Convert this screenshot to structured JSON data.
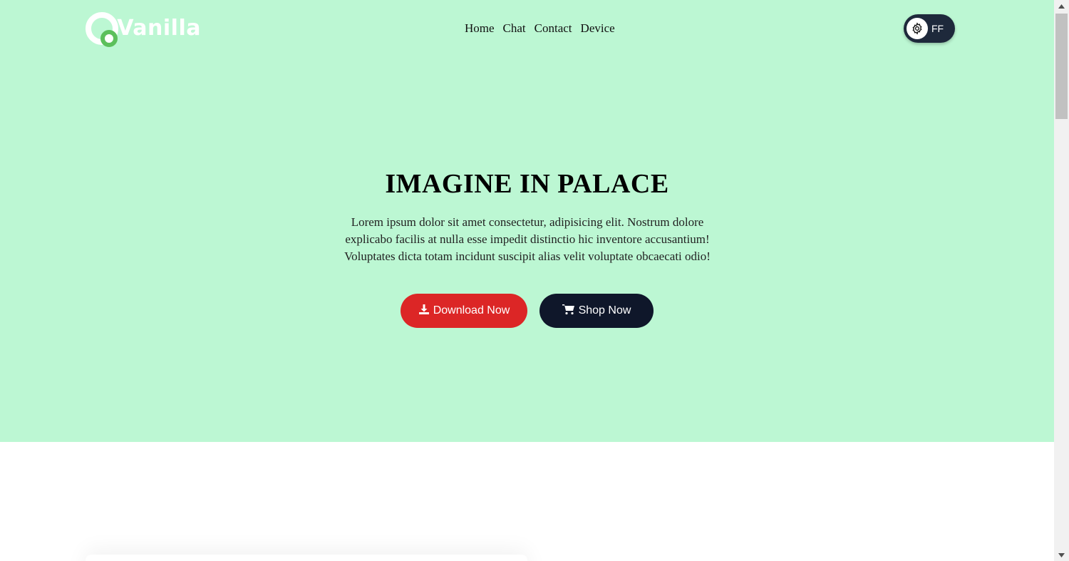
{
  "header": {
    "logo_text": "Vanilla",
    "nav": [
      "Home",
      "Chat",
      "Contact",
      "Device"
    ],
    "theme_toggle_label": "FF"
  },
  "hero": {
    "title": "IMAGINE IN PALACE",
    "description": "Lorem ipsum dolor sit amet consectetur, adipisicing elit. Nostrum dolore explicabo facilis at nulla esse impedit distinctio hic inventore accusantium! Voluptates dicta totam incidunt suscipit alias velit voluptate obcaecati odio!",
    "buttons": {
      "download_label": "Download Now",
      "download_icon": "download-icon",
      "shop_label": "Shop Now",
      "shop_icon": "cart-icon"
    }
  },
  "colors": {
    "hero_background": "#bcf7d3",
    "download_button": "#dc2626",
    "shop_button": "#0f172a",
    "toggle_background": "#1e293b",
    "logo_accent": "#5cc05c"
  }
}
